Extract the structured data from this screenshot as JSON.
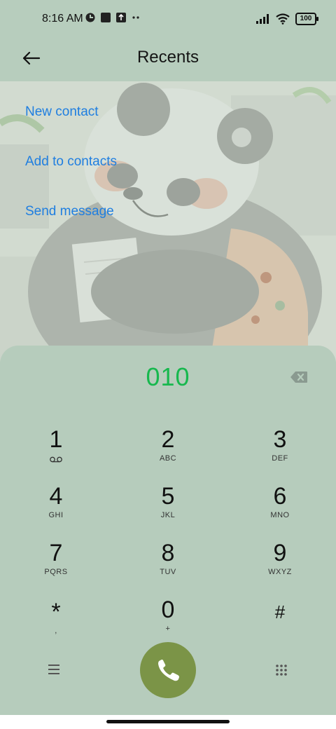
{
  "status_bar": {
    "time": "8:16 AM",
    "battery": "100"
  },
  "header": {
    "title": "Recents"
  },
  "actions": {
    "new_contact": "New contact",
    "add_to_contacts": "Add to contacts",
    "send_message": "Send message"
  },
  "dialer": {
    "number": "010",
    "keys": [
      {
        "digit": "1",
        "letters": ""
      },
      {
        "digit": "2",
        "letters": "ABC"
      },
      {
        "digit": "3",
        "letters": "DEF"
      },
      {
        "digit": "4",
        "letters": "GHI"
      },
      {
        "digit": "5",
        "letters": "JKL"
      },
      {
        "digit": "6",
        "letters": "MNO"
      },
      {
        "digit": "7",
        "letters": "PQRS"
      },
      {
        "digit": "8",
        "letters": "TUV"
      },
      {
        "digit": "9",
        "letters": "WXYZ"
      },
      {
        "digit": "*",
        "letters": ","
      },
      {
        "digit": "0",
        "letters": "+"
      },
      {
        "digit": "#",
        "letters": ""
      }
    ]
  },
  "colors": {
    "accent_link": "#1f7ee0",
    "number": "#17b84e",
    "call_button": "#7b9447",
    "background": "#b7cdbd"
  },
  "icons": [
    "back-arrow-icon",
    "backspace-icon",
    "voicemail-icon",
    "phone-icon",
    "menu-icon",
    "dialpad-icon"
  ]
}
